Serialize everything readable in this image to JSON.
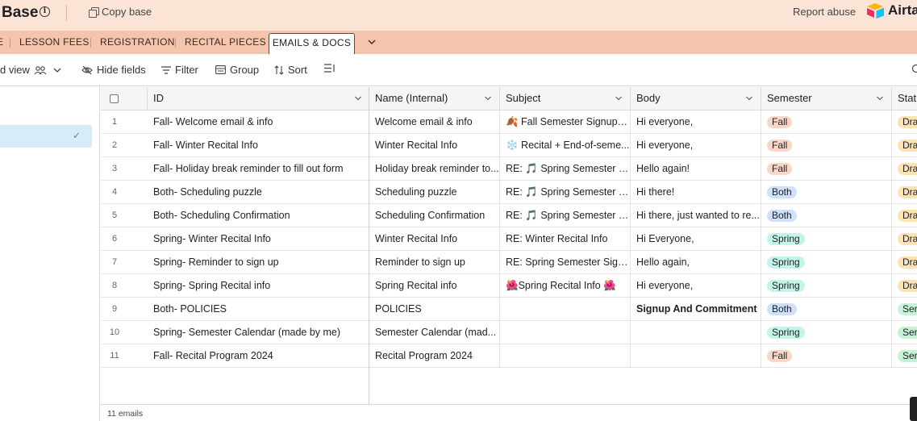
{
  "topbar": {
    "title": "Base",
    "copy_label": "Copy base",
    "report_label": "Report abuse",
    "logo_word": "Airta"
  },
  "tabs": {
    "partial_left": "E",
    "items": [
      "LESSON FEES",
      "REGISTRATION",
      "RECITAL PIECES"
    ],
    "active": "EMAILS & DOCS"
  },
  "toolbar": {
    "view_name": "d view",
    "hide_fields": "Hide fields",
    "filter": "Filter",
    "group": "Group",
    "sort": "Sort"
  },
  "columns": [
    "ID",
    "Name (Internal)",
    "Subject",
    "Body",
    "Semester",
    "Statu"
  ],
  "rows": [
    {
      "n": "1",
      "id": "Fall- Welcome email & info",
      "name": "Welcome email & info",
      "subject": "🍂 Fall Semester Signups...",
      "body": "Hi everyone,",
      "semester": "Fall",
      "status": "Dra"
    },
    {
      "n": "2",
      "id": "Fall- Winter Recital Info",
      "name": "Winter Recital Info",
      "subject": "❄️ Recital + End-of-seme...",
      "body": "Hi everyone,",
      "semester": "Fall",
      "status": "Dra"
    },
    {
      "n": "3",
      "id": "Fall- Holiday break reminder to fill out form",
      "name": "Holiday break reminder to...",
      "subject": "RE: 🎵 Spring Semester S...",
      "body": "Hello again!",
      "semester": "Fall",
      "status": "Dra"
    },
    {
      "n": "4",
      "id": "Both- Scheduling puzzle",
      "name": "Scheduling puzzle",
      "subject": "RE: 🎵 Spring Semester S...",
      "body": "Hi there!",
      "semester": "Both",
      "status": "Dra"
    },
    {
      "n": "5",
      "id": "Both- Scheduling Confirmation",
      "name": "Scheduling Confirmation",
      "subject": "RE: 🎵 Spring Semester S...",
      "body": "Hi there, just wanted to re...",
      "semester": "Both",
      "status": "Dra"
    },
    {
      "n": "6",
      "id": "Spring- Winter Recital Info",
      "name": "Winter Recital Info",
      "subject": "RE: Winter Recital Info",
      "body": "Hi Everyone,",
      "semester": "Spring",
      "status": "Dra"
    },
    {
      "n": "7",
      "id": "Spring- Reminder to sign up",
      "name": "Reminder to sign up",
      "subject": "RE: Spring Semester Sign...",
      "body": "Hello again,",
      "semester": "Spring",
      "status": "Dra"
    },
    {
      "n": "8",
      "id": "Spring- Spring Recital info",
      "name": "Spring Recital info",
      "subject": "🌺Spring Recital Info 🌺",
      "body": "Hi everyone,",
      "semester": "Spring",
      "status": "Dra"
    },
    {
      "n": "9",
      "id": "Both- POLICIES",
      "name": "POLICIES",
      "subject": "",
      "body": "Signup And Commitment",
      "semester": "Both",
      "status": "Ser"
    },
    {
      "n": "10",
      "id": "Spring- Semester Calendar (made by me)",
      "name": "Semester Calendar (mad...",
      "subject": "",
      "body": "",
      "semester": "Spring",
      "status": "Ser"
    },
    {
      "n": "11",
      "id": "Fall- Recital Program 2024",
      "name": "Recital Program 2024",
      "subject": "",
      "body": "",
      "semester": "Fall",
      "status": "Ser"
    }
  ],
  "footer": {
    "count": "11 emails"
  },
  "colors": {
    "fall": "#fbd6c6",
    "both": "#cfe0fa",
    "spring": "#c2f5e9",
    "draft": "#fde3b2",
    "sent": "#c6f3d4",
    "topbar_bg": "#fbe3d6",
    "tabbar_bg": "#f5c4ac"
  }
}
